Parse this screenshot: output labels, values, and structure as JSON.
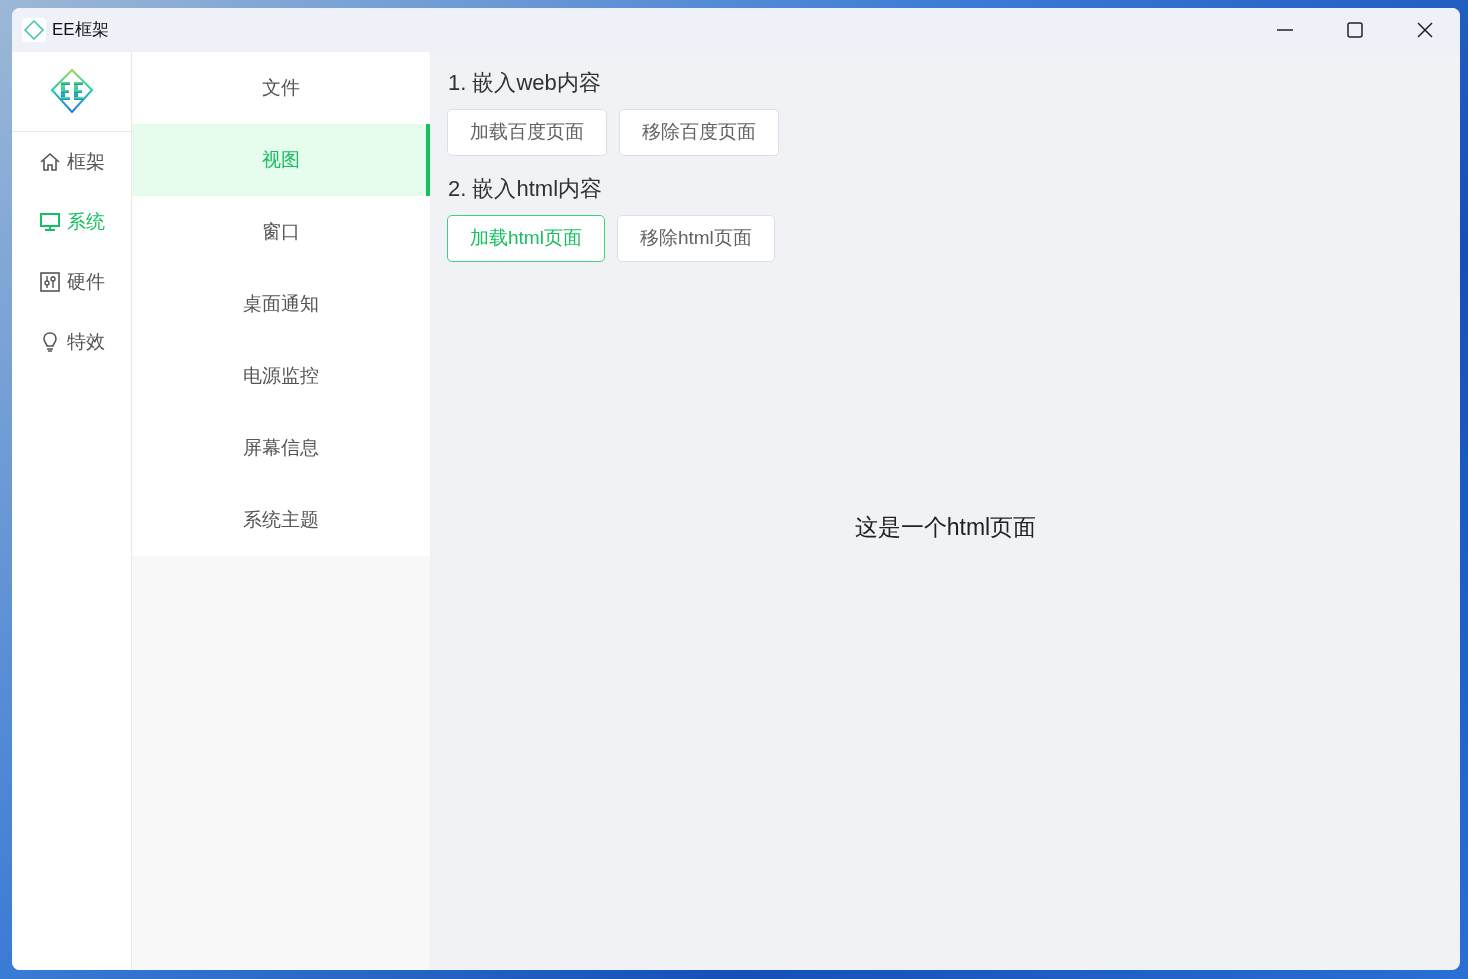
{
  "window": {
    "title": "EE框架"
  },
  "nav": [
    {
      "label": "框架",
      "selected": false
    },
    {
      "label": "系统",
      "selected": true
    },
    {
      "label": "硬件",
      "selected": false
    },
    {
      "label": "特效",
      "selected": false
    }
  ],
  "submenu": [
    {
      "label": "文件",
      "selected": false
    },
    {
      "label": "视图",
      "selected": true
    },
    {
      "label": "窗口",
      "selected": false
    },
    {
      "label": "桌面通知",
      "selected": false
    },
    {
      "label": "电源监控",
      "selected": false
    },
    {
      "label": "屏幕信息",
      "selected": false
    },
    {
      "label": "系统主题",
      "selected": false
    }
  ],
  "sections": [
    {
      "heading": "1. 嵌入web内容",
      "buttons": [
        {
          "label": "加载百度页面",
          "selected": false
        },
        {
          "label": "移除百度页面",
          "selected": false
        }
      ]
    },
    {
      "heading": "2. 嵌入html内容",
      "buttons": [
        {
          "label": "加载html页面",
          "selected": true
        },
        {
          "label": "移除html页面",
          "selected": false
        }
      ]
    }
  ],
  "embedded_page": {
    "text": "这是一个html页面"
  }
}
